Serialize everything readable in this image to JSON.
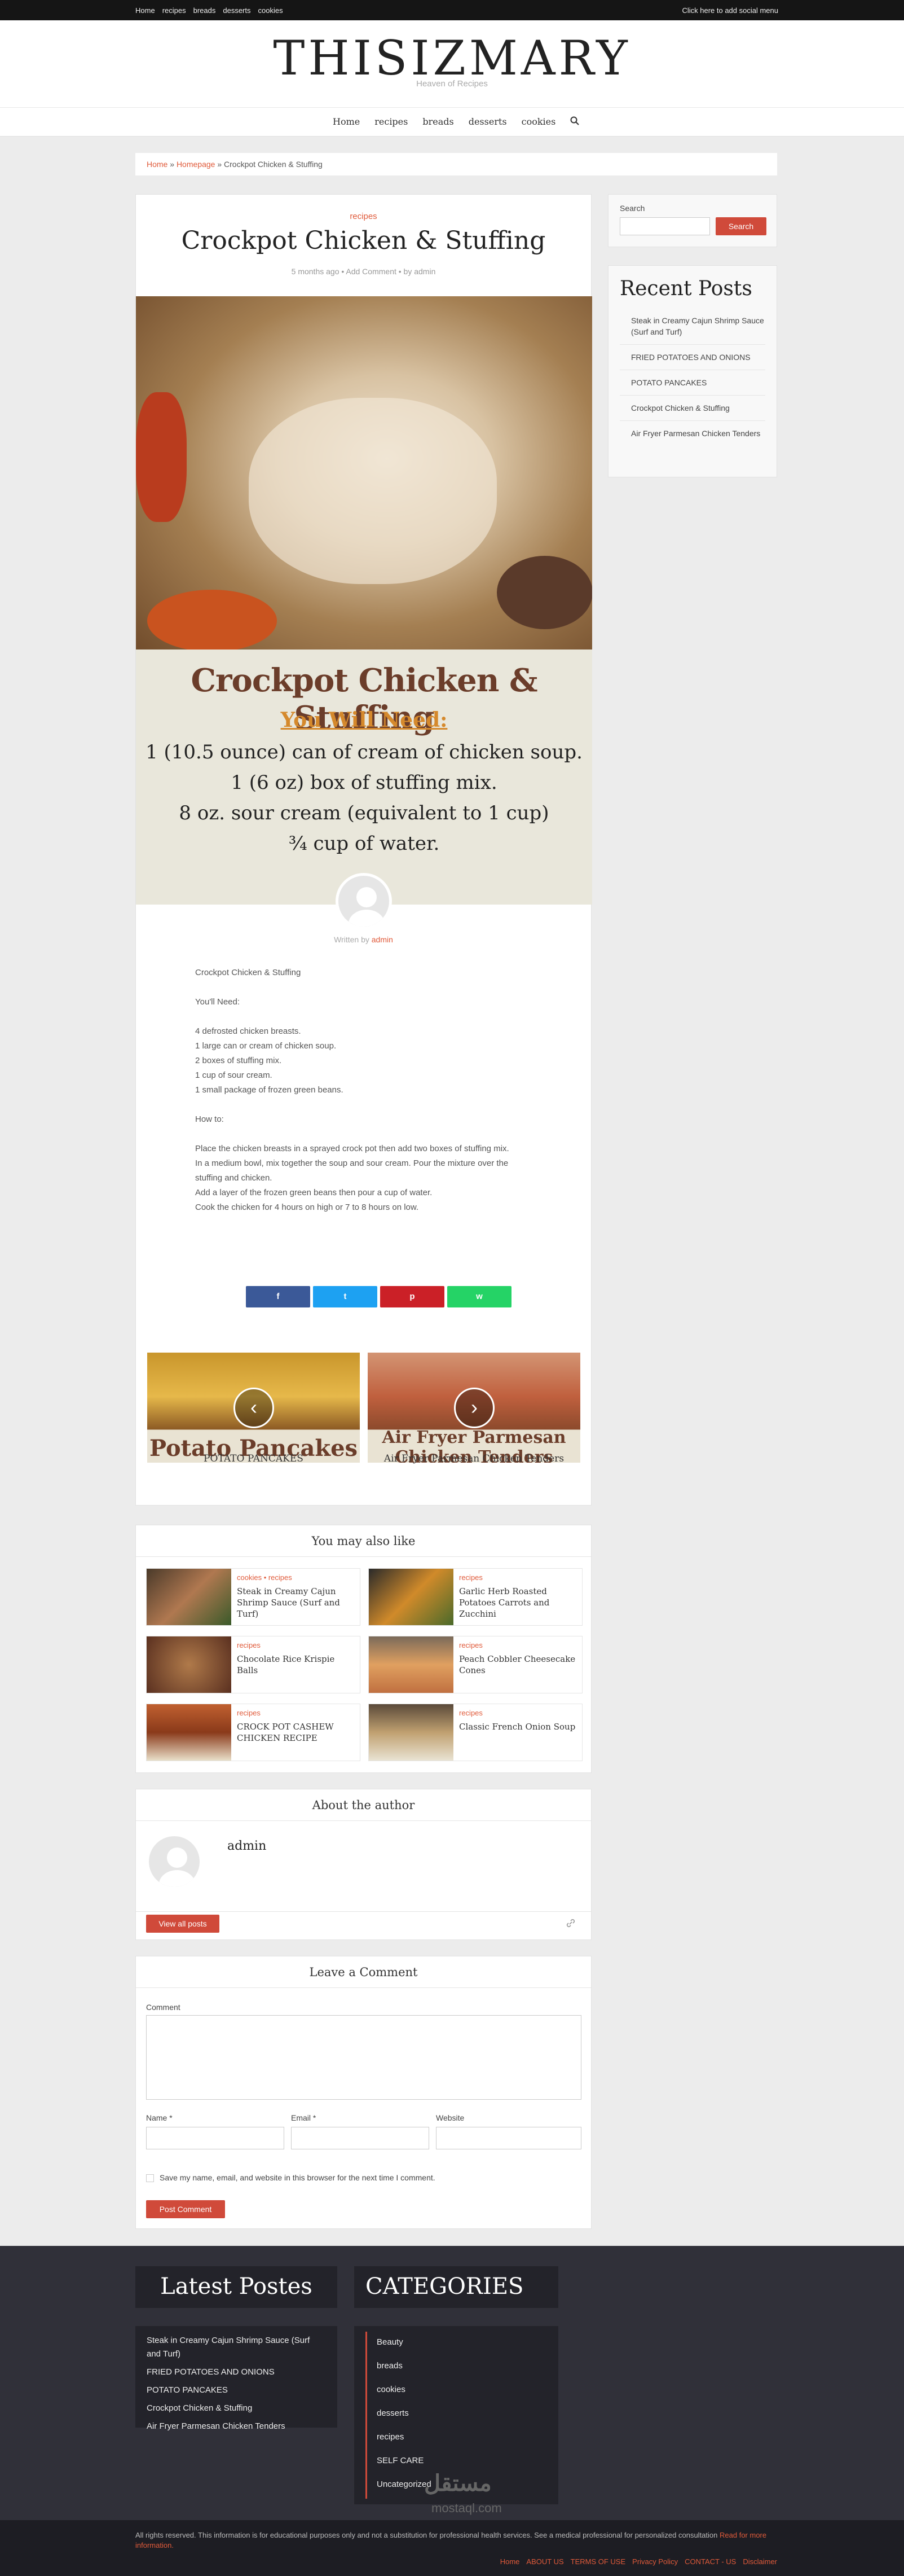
{
  "topbar": {
    "menu": [
      "Home",
      "recipes",
      "breads",
      "desserts",
      "cookies"
    ],
    "social": "Click here to add social menu"
  },
  "site": {
    "title": "THISIZMARY",
    "tagline": "Heaven of Recipes"
  },
  "nav": {
    "items": [
      "Home",
      "recipes",
      "breads",
      "desserts",
      "cookies"
    ],
    "search_icon": "search-icon"
  },
  "breadcrumb": {
    "home": "Home",
    "sep": "»",
    "homepage": "Homepage",
    "current": "Crockpot Chicken & Stuffing"
  },
  "post": {
    "category": "recipes",
    "title": "Crockpot Chicken & Stuffing",
    "meta": "5 months ago • Add Comment • by admin",
    "hero": {
      "title": "Crockpot Chicken & Stuffing",
      "need": "You Will Need:",
      "ingredients": [
        "1 (10.5 ounce) can of cream of chicken soup.",
        "1 (6 oz) box of stuffing mix.",
        "8 oz. sour cream (equivalent to 1 cup)",
        "¾ cup of water."
      ]
    },
    "written_by": "Written by",
    "author": "admin",
    "body": {
      "p1": "Crockpot Chicken & Stuffing",
      "p2": "You'll Need:",
      "list1": [
        "4 defrosted chicken breasts.",
        "1 large can or cream of chicken soup.",
        "2 boxes of stuffing mix.",
        "1 cup of sour cream.",
        "1 small package of frozen green beans."
      ],
      "p3": "How to:",
      "list2": [
        "Place the chicken breasts in a sprayed crock pot then add two boxes of stuffing mix.",
        "In a medium bowl, mix together the soup and sour cream. Pour the mixture over the stuffing and chicken.",
        "Add a layer of the frozen green beans then pour a cup of water.",
        "Cook the chicken for 4 hours on high or 7 to 8 hours on low."
      ]
    },
    "share": {
      "facebook": "f",
      "twitter": "t",
      "pinterest": "p",
      "whatsapp": "w"
    },
    "prev": {
      "image_text": "Potato Pancakes",
      "title": "POTATO PANCAKES",
      "arrow": "‹"
    },
    "next": {
      "image_text": "Air Fryer Parmesan Chicken Tenders",
      "title": "Air Fryer Parmesan Chicken Tenders",
      "arrow": "›"
    }
  },
  "also": {
    "title": "You may also like",
    "items": [
      {
        "cat": "cookies • recipes",
        "title": "Steak in Creamy Cajun Shrimp Sauce (Surf and Turf)"
      },
      {
        "cat": "recipes",
        "title": "Garlic Herb Roasted Potatoes Carrots and Zucchini"
      },
      {
        "cat": "recipes",
        "title": "Chocolate Rice Krispie Balls"
      },
      {
        "cat": "recipes",
        "title": "Peach Cobbler Cheesecake Cones"
      },
      {
        "cat": "recipes",
        "title": "CROCK POT CASHEW CHICKEN RECIPE"
      },
      {
        "cat": "recipes",
        "title": "Classic French Onion Soup"
      }
    ]
  },
  "about": {
    "title": "About the author",
    "name": "admin",
    "button": "View all posts"
  },
  "comment": {
    "title": "Leave a Comment",
    "comment": "Comment",
    "name": "Name *",
    "email": "Email *",
    "website": "Website",
    "save": "Save my name, email, and website in this browser for the next time I comment.",
    "button": "Post Comment"
  },
  "sidebar": {
    "search_label": "Search",
    "search_button": "Search",
    "recent_title": "Recent Posts",
    "recent": [
      "Steak in Creamy Cajun Shrimp Sauce (Surf and Turf)",
      "FRIED POTATOES AND ONIONS",
      "POTATO PANCAKES",
      "Crockpot Chicken & Stuffing",
      "Air Fryer Parmesan Chicken Tenders"
    ]
  },
  "footer": {
    "latest_title": "Latest Postes",
    "latest": [
      "Steak in Creamy Cajun Shrimp Sauce (Surf and Turf)",
      "FRIED POTATOES AND ONIONS",
      "POTATO PANCAKES",
      "Crockpot Chicken & Stuffing",
      "Air Fryer Parmesan Chicken Tenders"
    ],
    "cat_title": "CATEGORIES",
    "cats": [
      "Beauty",
      "breads",
      "cookies",
      "desserts",
      "recipes",
      "SELF CARE",
      "Uncategorized"
    ],
    "copyright": "All rights reserved. This information is for educational purposes only and not a substitution for professional health services. See a medical professional for personalized consultation",
    "read_more": "Read for more information.",
    "links": [
      "Home",
      "ABOUT US",
      "TERMS OF USE",
      "Privacy Policy",
      "CONTACT - US",
      "Disclaimer"
    ],
    "watermark": "مستقل",
    "watermark2": "mostaql.com"
  },
  "colors": {
    "accent": "#e05a3a",
    "facebook": "#3b5998",
    "twitter": "#1da1f2",
    "pinterest": "#cb2027",
    "whatsapp": "#25d366"
  }
}
